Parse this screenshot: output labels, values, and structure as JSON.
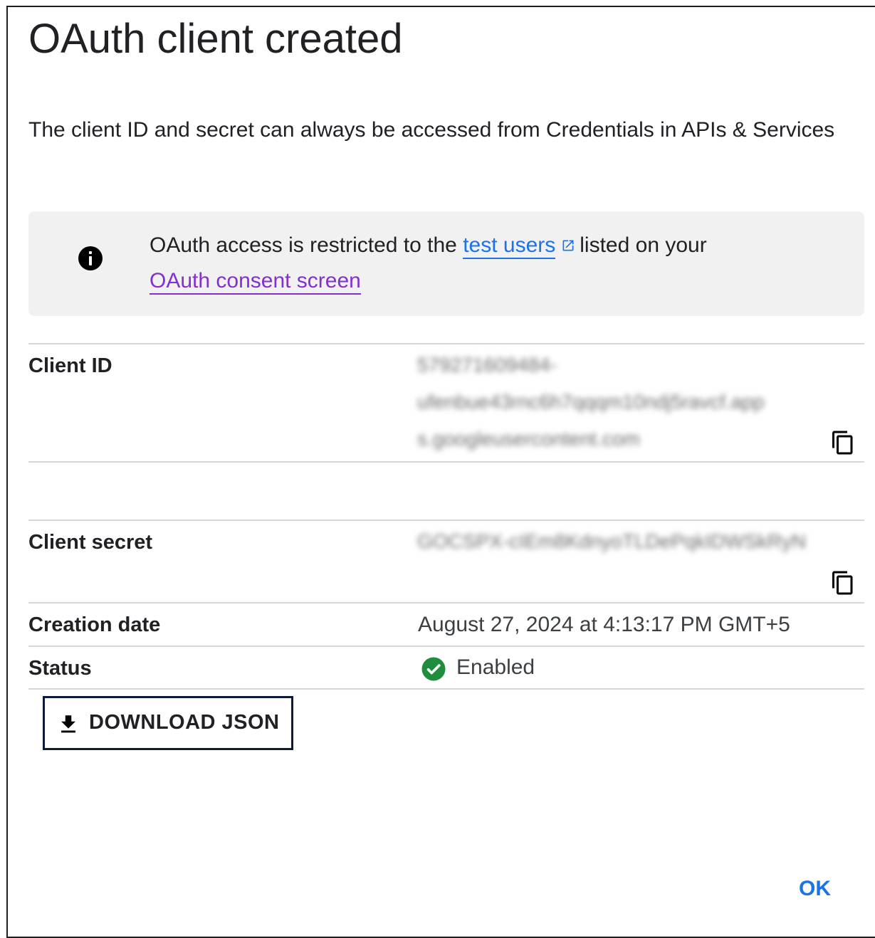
{
  "dialog": {
    "title": "OAuth client created",
    "description": "The client ID and secret can always be accessed from Credentials in APIs & Services"
  },
  "notice": {
    "icon": "info-icon",
    "text_before": "OAuth access is restricted to the",
    "test_users_link": "test users",
    "link_icon": "external-link-icon",
    "text_after": "listed on your",
    "consent_screen_link": "OAuth consent screen"
  },
  "client_id": {
    "label": "Client ID",
    "value_line1": "579271609484-",
    "value_line2": "ufenbue43rnc6h7qqqm10ndj5ravcf.app",
    "value_line3": "s.googleusercontent.com",
    "copy_icon": "copy-icon"
  },
  "client_secret": {
    "label": "Client secret",
    "value": "GOCSPX-cIEm8KdnyoTLDePqkIDWSkRyN",
    "copy_icon": "copy-icon"
  },
  "creation_date": {
    "label": "Creation date",
    "value": "August 27, 2024 at 4:13:17 PM GMT+5"
  },
  "status": {
    "label": "Status",
    "value": "Enabled",
    "icon": "check-circle-icon",
    "color": "#1e8e3e"
  },
  "actions": {
    "download_label": "DOWNLOAD JSON",
    "download_icon": "download-icon",
    "ok_label": "OK"
  },
  "colors": {
    "link": "#1a73e8",
    "visited_link": "#8430ce",
    "notice_bg": "#f1f1f1"
  }
}
